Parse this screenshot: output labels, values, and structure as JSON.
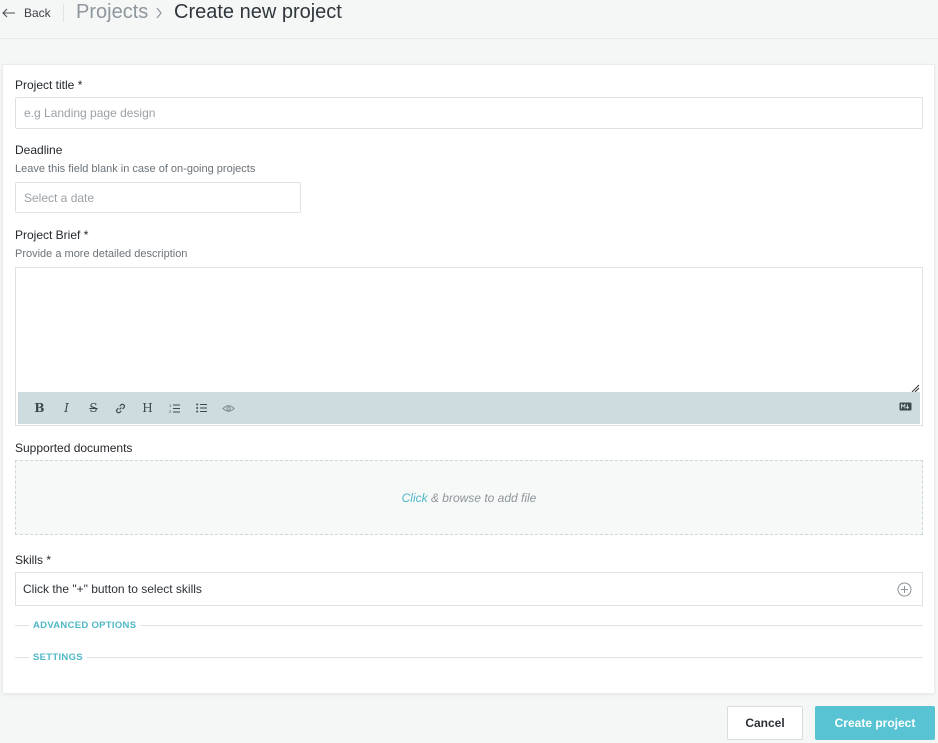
{
  "header": {
    "back_label": "Back",
    "breadcrumb_root": "Projects",
    "breadcrumb_current": "Create new project"
  },
  "form": {
    "title": {
      "label": "Project title *",
      "placeholder": "e.g Landing page design",
      "value": ""
    },
    "deadline": {
      "label": "Deadline",
      "hint": "Leave this field blank in case of on-going projects",
      "placeholder": "Select a date",
      "value": ""
    },
    "brief": {
      "label": "Project Brief *",
      "hint": "Provide a more detailed description",
      "value": "",
      "toolbar": [
        "bold-icon",
        "italic-icon",
        "strikethrough-icon",
        "link-icon",
        "heading-icon",
        "ordered-list-icon",
        "unordered-list-icon",
        "preview-eye-icon",
        "markdown-icon"
      ]
    },
    "documents": {
      "label": "Supported documents",
      "click_text": "Click",
      "rest_text": " & browse to add file"
    },
    "skills": {
      "label": "Skills *",
      "placeholder_text": "Click the \"+\" button to select skills"
    },
    "sections": {
      "advanced": "ADVANCED OPTIONS",
      "settings": "SETTINGS"
    }
  },
  "actions": {
    "cancel_label": "Cancel",
    "create_label": "Create project"
  },
  "colors": {
    "accent": "#58c4d3",
    "accent_text": "#4fb7c7",
    "toolbar_bg": "#cfdcdf",
    "page_bg": "#f5f7f7"
  }
}
